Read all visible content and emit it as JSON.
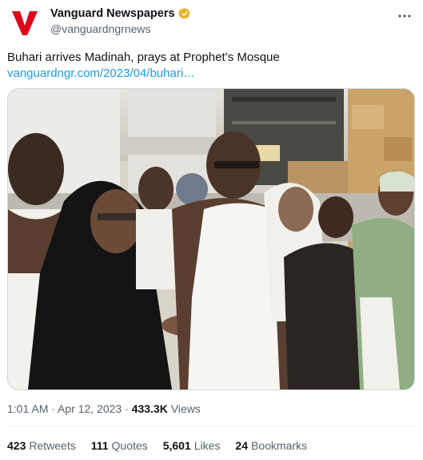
{
  "author": {
    "display_name": "Vanguard Newspapers",
    "handle": "@vanguardngrnews",
    "logo_letter": "V",
    "logo_color": "#e2001a",
    "verified_badge_color": "#e8b12c"
  },
  "tweet": {
    "text": "Buhari arrives Madinah, prays at Prophet’s Mosque",
    "link": "vanguardngr.com/2023/04/buhari…"
  },
  "meta": {
    "time": "1:01 AM",
    "sep1": " · ",
    "date": "Apr 12, 2023",
    "sep2": " · ",
    "views": "433.3K",
    "views_label": " Views"
  },
  "stats": {
    "retweets_count": "423",
    "retweets_label": "Retweets",
    "quotes_count": "111",
    "quotes_label": "Quotes",
    "likes_count": "5,601",
    "likes_label": "Likes",
    "bookmarks_count": "24",
    "bookmarks_label": "Bookmarks"
  },
  "colors": {
    "link": "#1d9bf0",
    "secondary_text": "#536471",
    "primary_text": "#0f1419"
  },
  "icons": {
    "more": "more-icon",
    "verified": "verified-badge-icon"
  }
}
